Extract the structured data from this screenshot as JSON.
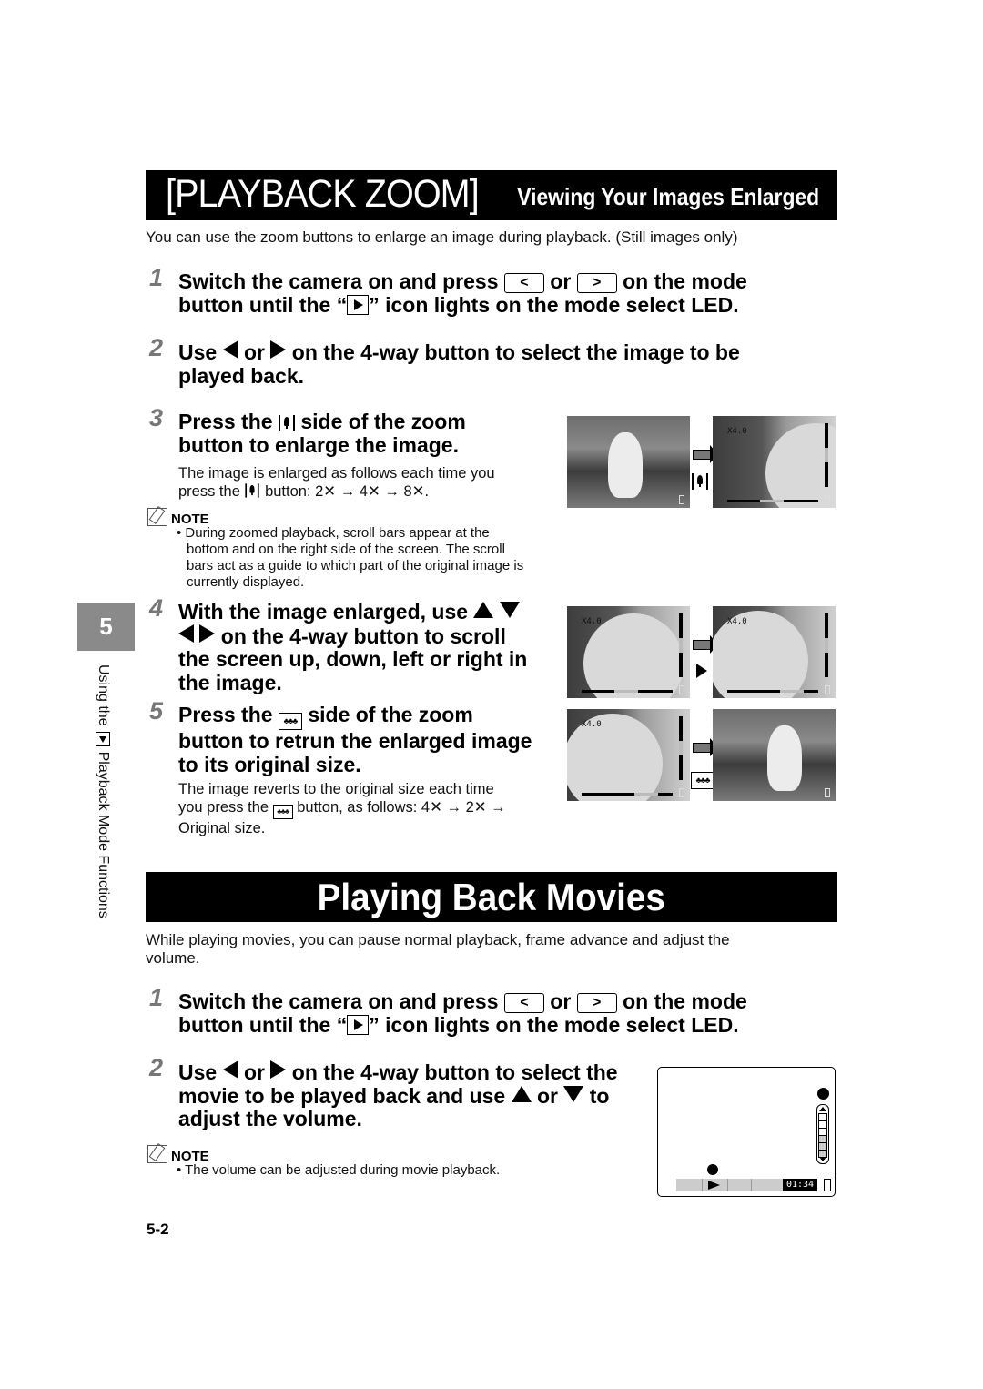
{
  "zoom_section": {
    "title_main": "[PLAYBACK ZOOM]",
    "title_sub": "Viewing Your Images Enlarged",
    "intro": "You can use the zoom buttons to enlarge an image during playback. (Still images only)",
    "steps": [
      {
        "num": "1",
        "line1_a": "Switch the camera on and press",
        "key_left": "<",
        "or": "or",
        "key_right": ">",
        "line1_b": "on the mode",
        "line2_a": "button until the “",
        "line2_b": "” icon lights on the mode select LED."
      },
      {
        "num": "2",
        "a": "Use",
        "or": "or",
        "b": "on the 4-way button to select the image to be",
        "line2": "played back."
      },
      {
        "num": "3",
        "a": "Press the",
        "b": "side of the zoom",
        "line2": "button to enlarge the image.",
        "body1": "The image is enlarged as follows each time you",
        "body2_a": "press the",
        "body2_b": "button: 2✕ → 4✕ → 8✕."
      },
      {
        "num": "4",
        "line1": "With the image enlarged, use",
        "line2": "on the 4-way button to scroll",
        "line3": "the screen up, down, left or right in",
        "line4": "the image."
      },
      {
        "num": "5",
        "a": "Press the",
        "b": "side of the zoom",
        "line2": "button to retrun the enlarged image",
        "line3": "to its original size.",
        "body1": "The image reverts to the original size each time",
        "body2_a": "you press the",
        "body2_b": "button, as follows: 4✕ → 2✕ →",
        "body3": "Original size."
      }
    ],
    "note": {
      "label": "NOTE",
      "lines": [
        "• During zoomed playback, scroll bars appear at the",
        "bottom and on the right side of the screen. The scroll",
        "bars act as a guide to which part of the original image is",
        "currently displayed."
      ]
    },
    "zoom_label": "X4.0",
    "wide_icon_glyph": "♣♣♣"
  },
  "movie_section": {
    "title": "Playing Back Movies",
    "intro_1": "While playing movies, you can pause normal playback, frame advance and adjust the",
    "intro_2": "volume.",
    "steps": [
      {
        "num": "1",
        "line1_a": "Switch the camera on and press",
        "key_left": "<",
        "or": "or",
        "key_right": ">",
        "line1_b": "on the mode",
        "line2_a": "button until the “",
        "line2_b": "” icon lights on the mode select LED."
      },
      {
        "num": "2",
        "a": "Use",
        "or": "or",
        "b": "on the 4-way button to select the",
        "line2_a": "movie to be played back and use",
        "line2_or": "or",
        "line2_b": "to",
        "line3": "adjust the volume."
      }
    ],
    "note": {
      "label": "NOTE",
      "line": "• The volume can be adjusted during movie playback."
    },
    "lcd": {
      "time": "01:34",
      "volume_level": 0.6
    }
  },
  "side_tab": {
    "chapter": "5",
    "text_a": "Using the",
    "text_b": "Playback Mode Functions"
  },
  "page_number": "5-2"
}
